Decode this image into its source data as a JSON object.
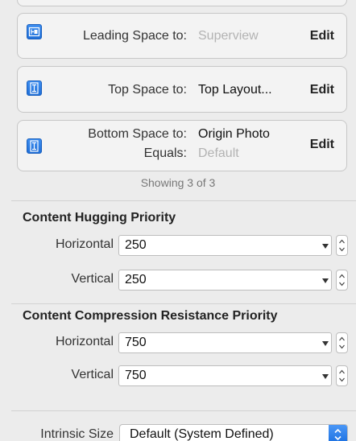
{
  "constraints": [
    {
      "icon": "leading-constraint-icon",
      "label": "Leading Space to:",
      "value": "Superview",
      "value_style": "dim",
      "action": "Edit"
    },
    {
      "icon": "vertical-constraint-icon",
      "label": "Top Space to:",
      "value": "Top Layout...",
      "value_style": "dark",
      "action": "Edit"
    },
    {
      "icon": "vertical-constraint-icon",
      "label": "Bottom Space to:",
      "value": "Origin Photo",
      "value_style": "dark",
      "label2": "Equals:",
      "value2": "Default",
      "action": "Edit"
    }
  ],
  "showing_text": "Showing 3 of 3",
  "content_hugging": {
    "title": "Content Hugging Priority",
    "horizontal_label": "Horizontal",
    "horizontal_value": "250",
    "vertical_label": "Vertical",
    "vertical_value": "250"
  },
  "compression_resistance": {
    "title": "Content Compression Resistance Priority",
    "horizontal_label": "Horizontal",
    "horizontal_value": "750",
    "vertical_label": "Vertical",
    "vertical_value": "750"
  },
  "intrinsic_size": {
    "label": "Intrinsic Size",
    "value": "Default (System Defined)"
  },
  "colors": {
    "accent": "#1f6fd8",
    "panel_bg": "#ececec",
    "card_bg": "#f3f3f3",
    "dim_text": "#b3b3b3"
  }
}
